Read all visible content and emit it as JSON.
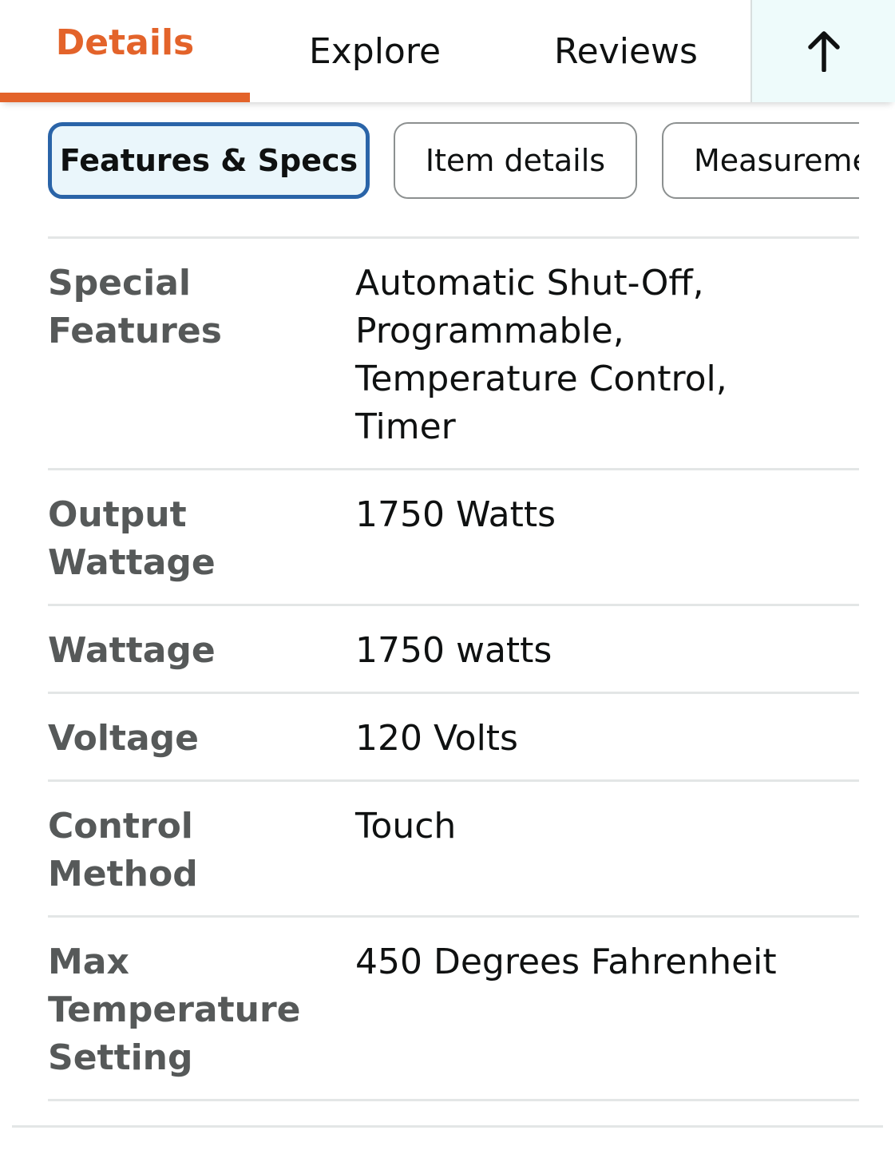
{
  "tabs": {
    "details": "Details",
    "explore": "Explore",
    "reviews": "Reviews",
    "back_to_top_icon": "arrow-up-icon"
  },
  "chips": {
    "features_specs": "Features & Specs",
    "item_details": "Item details",
    "measurements": "Measurements"
  },
  "specs": {
    "special_features": {
      "label": "Special\nFeatures",
      "value": "Automatic Shut-Off,\nProgrammable,\nTemperature Control,\nTimer"
    },
    "output_wattage": {
      "label": "Output\nWattage",
      "value": "1750 Watts"
    },
    "wattage": {
      "label": "Wattage",
      "value": "1750 watts"
    },
    "voltage": {
      "label": "Voltage",
      "value": "120 Volts"
    },
    "control_method": {
      "label": "Control\nMethod",
      "value": "Touch"
    },
    "max_temperature": {
      "label": "Max\nTemperature\nSetting",
      "value": "450 Degrees Fahrenheit"
    }
  },
  "colors": {
    "accent_orange": "#e3632a",
    "selected_chip_border": "#2a64a8",
    "selected_chip_bg": "#eaf6fb",
    "label_gray": "#565959",
    "text": "#0f1111"
  }
}
